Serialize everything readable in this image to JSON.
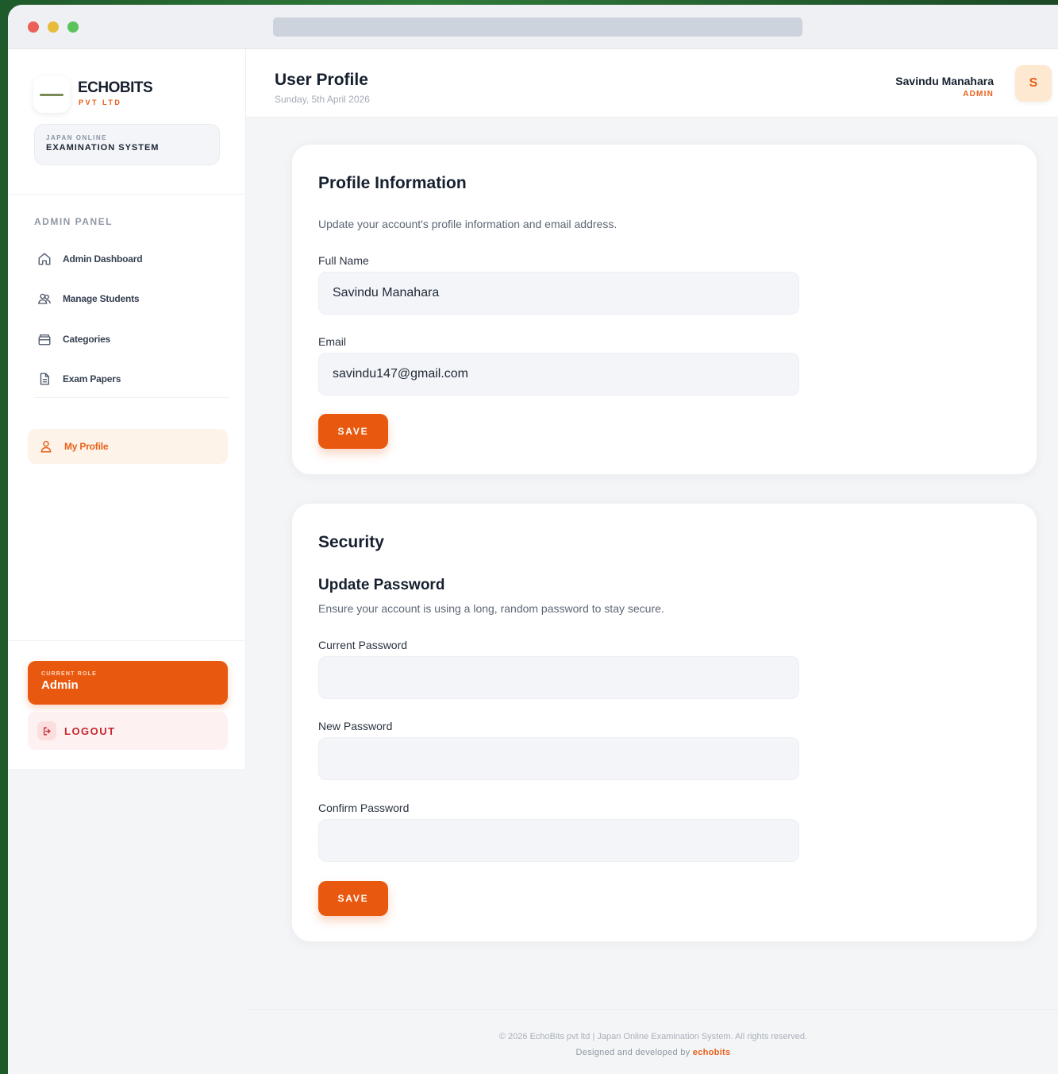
{
  "brand": {
    "name": "ECHOBITS",
    "subtitle": "PVT LTD",
    "system_line1": "JAPAN ONLINE",
    "system_line2": "EXAMINATION SYSTEM"
  },
  "sidebar": {
    "section_label": "ADMIN PANEL",
    "items": [
      {
        "label": "Admin Dashboard",
        "icon": "home-icon"
      },
      {
        "label": "Manage Students",
        "icon": "users-icon"
      },
      {
        "label": "Categories",
        "icon": "folder-icon"
      },
      {
        "label": "Exam Papers",
        "icon": "document-icon"
      }
    ],
    "active_item": {
      "label": "My Profile",
      "icon": "user-icon"
    },
    "role_label": "CURRENT ROLE",
    "role_value": "Admin",
    "logout_label": "LOGOUT"
  },
  "header": {
    "title": "User Profile",
    "date": "Sunday, 5th April 2026",
    "user_name": "Savindu Manahara",
    "user_role": "ADMIN",
    "avatar_initial": "S"
  },
  "profile": {
    "title": "Profile Information",
    "description": "Update your account's profile information and email address.",
    "full_name_label": "Full Name",
    "full_name_value": "Savindu Manahara",
    "email_label": "Email",
    "email_value": "savindu147@gmail.com",
    "save_label": "SAVE"
  },
  "security": {
    "title": "Security",
    "subtitle": "Update Password",
    "description": "Ensure your account is using a long, random password to stay secure.",
    "current_label": "Current Password",
    "new_label": "New Password",
    "confirm_label": "Confirm Password",
    "save_label": "SAVE"
  },
  "footer": {
    "copyright": "© 2026 EchoBits pvt ltd | Japan Online Examination System. All rights reserved.",
    "designed_prefix": "Designed and developed by",
    "designed_brand": "echobits"
  },
  "colors": {
    "accent": "#e8590f",
    "page_bg": "#f4f5f7",
    "danger": "#c7262e"
  }
}
